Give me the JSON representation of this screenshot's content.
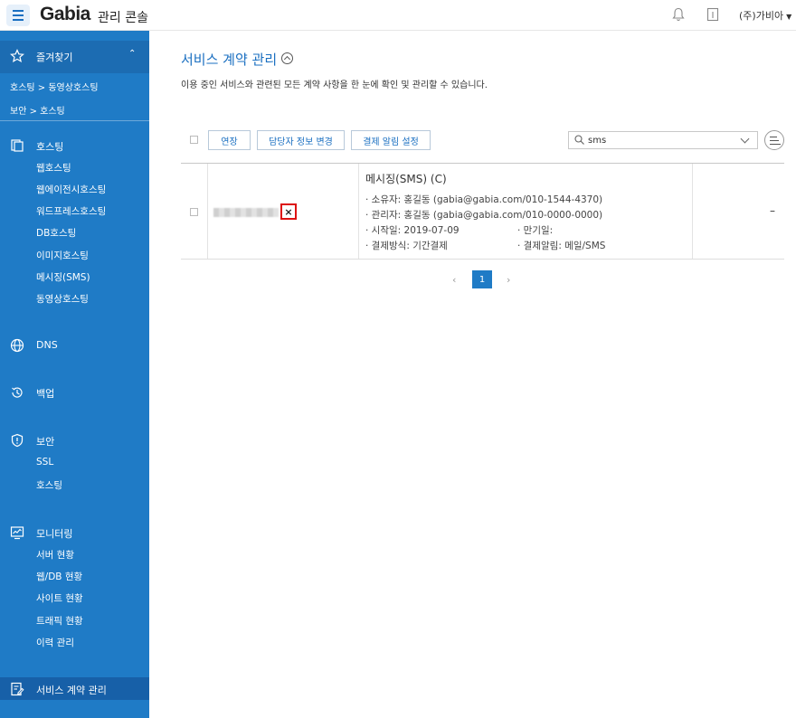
{
  "header": {
    "brand": "Gabia",
    "brand_sub": "관리 콘솔",
    "account": "(주)가비아"
  },
  "sidebar": {
    "favorites_label": "즐겨찾기",
    "favorites": [
      "호스팅 > 동영상호스팅",
      "보안 > 호스팅"
    ],
    "sections": [
      {
        "label": "호스팅",
        "items": [
          "웹호스팅",
          "웹에이전시호스팅",
          "워드프레스호스팅",
          "DB호스팅",
          "이미지호스팅",
          "메시징(SMS)",
          "동영상호스팅"
        ]
      },
      {
        "label": "DNS",
        "items": []
      },
      {
        "label": "백업",
        "items": []
      },
      {
        "label": "보안",
        "items": [
          "SSL",
          "호스팅"
        ]
      },
      {
        "label": "모니터링",
        "items": [
          "서버 현황",
          "웹/DB 현황",
          "사이트 현황",
          "트래픽 현황",
          "이력 관리"
        ]
      }
    ],
    "active_label": "서비스 계약 관리"
  },
  "main": {
    "title": "서비스 계약 관리",
    "description": "이용 중인 서비스와 관련된 모든 계약 사항을 한 눈에 확인 및 관리할 수 있습니다.",
    "buttons": {
      "renew": "연장",
      "change_manager": "담당자 정보 변경",
      "payment_alert": "결제 알림 설정"
    },
    "search_value": "sms",
    "row": {
      "close": "×",
      "service_name": "메시징(SMS) (C)",
      "owner": "· 소유자: 홍길동 (gabia@gabia.com/010-1544-4370)",
      "manager": "· 관리자: 홍길동 (gabia@gabia.com/010-0000-0000)",
      "start": "· 시작일: 2019-07-09",
      "expire": "· 만기일:",
      "payment_method": "· 결제방식: 기간결제",
      "payment_alert": "· 결제알림: 메일/SMS",
      "status": "–"
    },
    "pagination": {
      "prev": "‹",
      "current": "1",
      "next": "›"
    }
  }
}
